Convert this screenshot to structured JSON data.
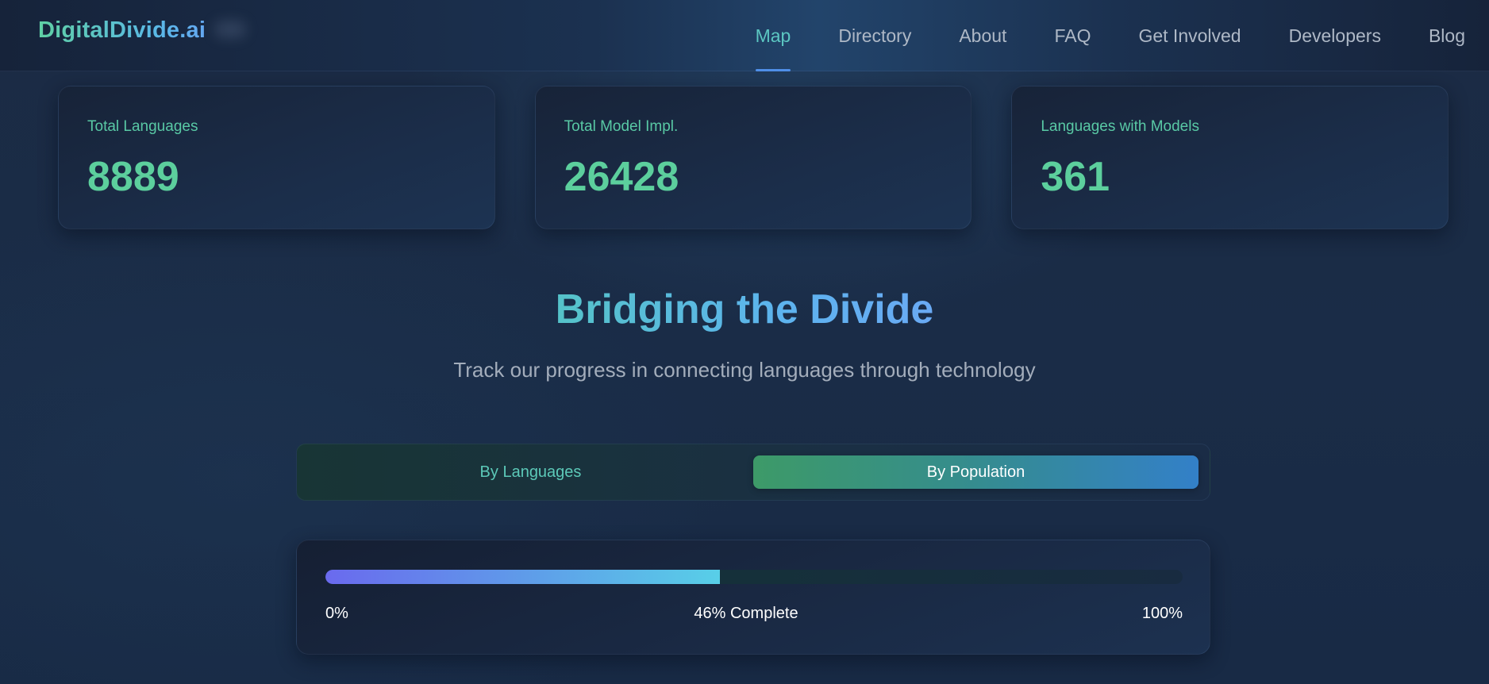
{
  "header": {
    "logo": "DigitalDivide.ai",
    "nav": [
      {
        "label": "Map",
        "active": true
      },
      {
        "label": "Directory",
        "active": false
      },
      {
        "label": "About",
        "active": false
      },
      {
        "label": "FAQ",
        "active": false
      },
      {
        "label": "Get Involved",
        "active": false
      },
      {
        "label": "Developers",
        "active": false
      },
      {
        "label": "Blog",
        "active": false
      }
    ]
  },
  "stats": [
    {
      "label": "Total Languages",
      "value": "8889"
    },
    {
      "label": "Total Model Impl.",
      "value": "26428"
    },
    {
      "label": "Languages with Models",
      "value": "361"
    }
  ],
  "hero": {
    "title": "Bridging the Divide",
    "subtitle": "Track our progress in connecting languages through technology"
  },
  "toggle": {
    "options": [
      {
        "label": "By Languages",
        "active": false
      },
      {
        "label": "By Population",
        "active": true
      }
    ]
  },
  "progress": {
    "percent": 46,
    "min_label": "0%",
    "status_label": "46% Complete",
    "max_label": "100%"
  },
  "colors": {
    "accent_green": "#5ccf9d",
    "accent_blue": "#4f8fe8",
    "background": "#1a2c47"
  }
}
